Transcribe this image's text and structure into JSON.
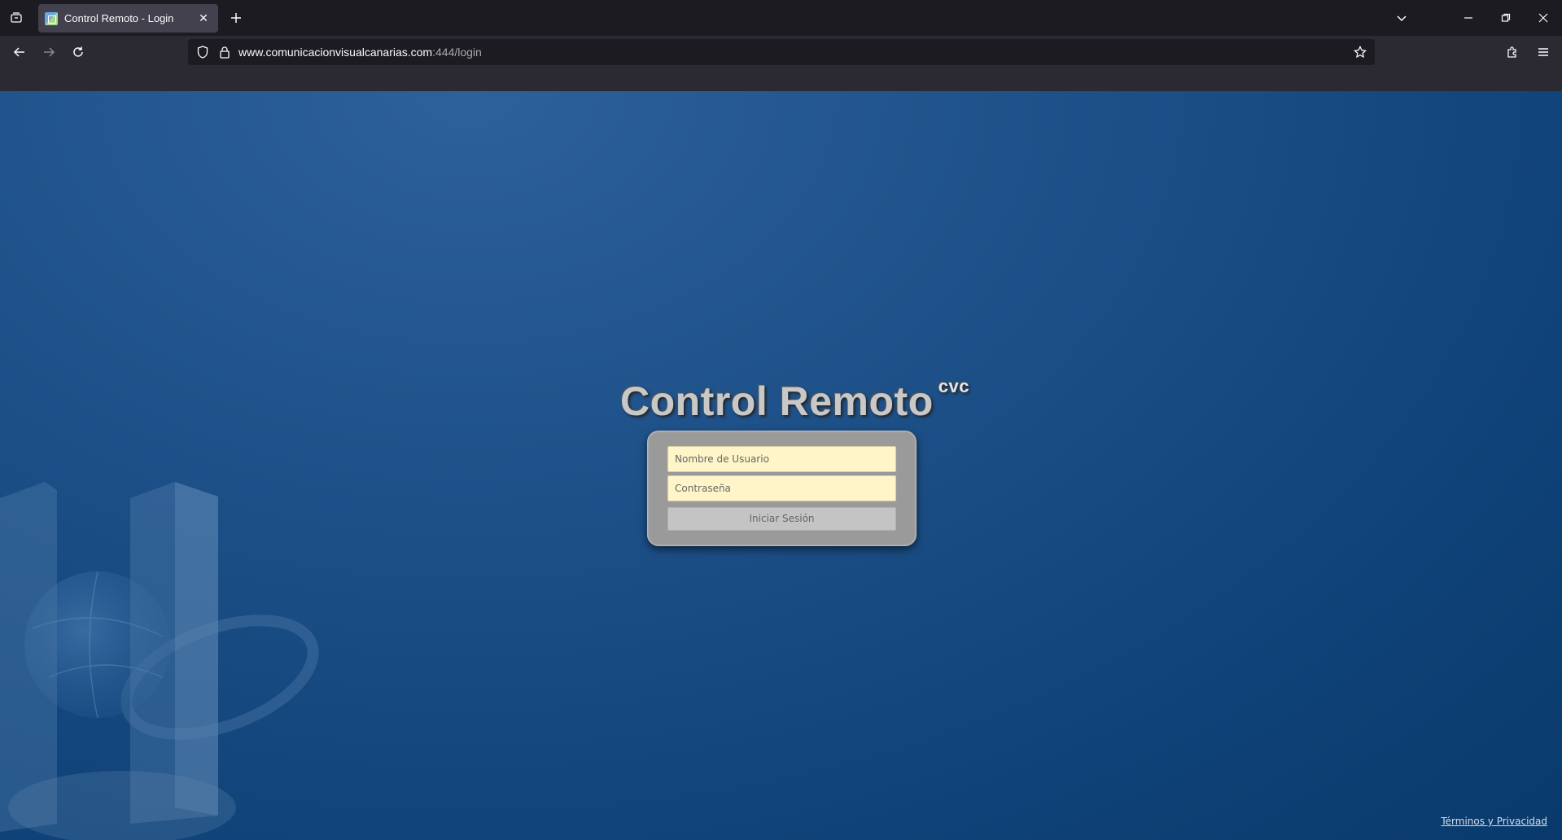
{
  "browser": {
    "tab_title": "Control Remoto - Login",
    "url_host": "www.comunicacionvisualcanarias.com",
    "url_rest": ":444/login",
    "icons": {
      "tab_list": "tab-list-icon",
      "close_tab": "close-icon",
      "new_tab": "plus-icon",
      "tabs_dropdown": "chevron-down-icon",
      "minimize": "minimize-icon",
      "restore": "restore-icon",
      "close_window": "close-icon",
      "back": "arrow-left-icon",
      "forward": "arrow-right-icon",
      "reload": "reload-icon",
      "shield": "shield-icon",
      "lock": "lock-icon",
      "bookmark": "star-icon",
      "extensions": "puzzle-icon",
      "menu": "hamburger-menu-icon"
    }
  },
  "page": {
    "title": "Control Remoto",
    "title_superscript": "cvc",
    "username_placeholder": "Nombre de Usuario",
    "password_placeholder": "Contraseña",
    "login_button": "Iniciar Sesión",
    "terms_link": "Términos y Privacidad",
    "colors": {
      "background": "#1f528a",
      "login_box": "#9a9a9a",
      "input_bg": "#fff5c8",
      "button_bg": "#c4c4c4"
    }
  }
}
